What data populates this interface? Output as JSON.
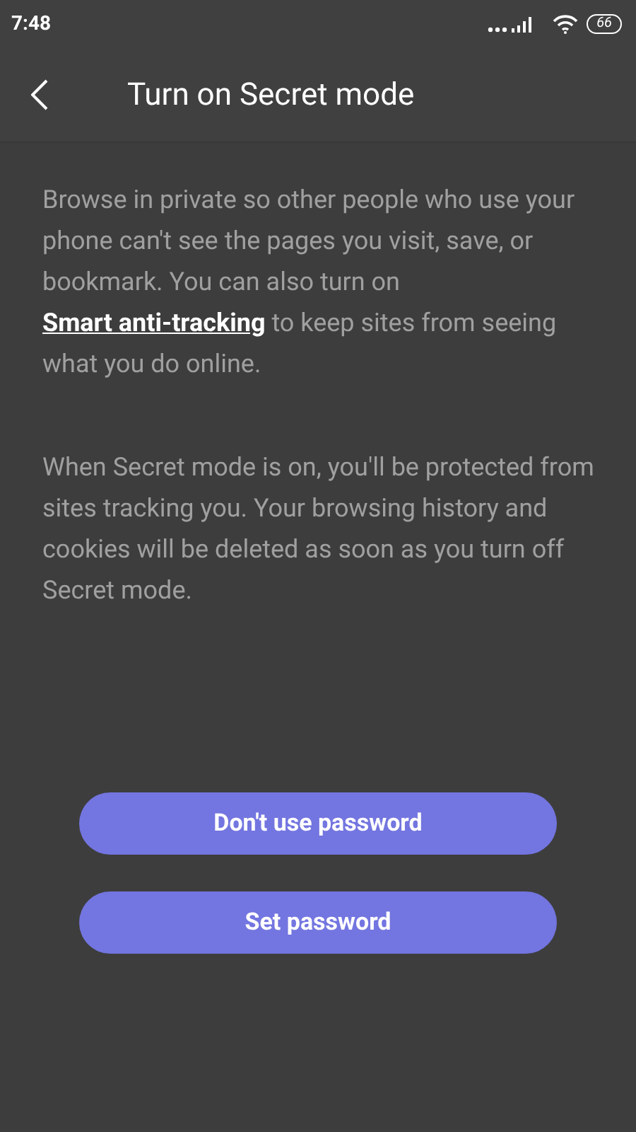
{
  "status_bar": {
    "time": "7:48",
    "battery": "66"
  },
  "header": {
    "title": "Turn on Secret mode"
  },
  "intro": {
    "text_before": "Browse in private so other people who use your phone can't see the pages you visit, save, or bookmark. You can also turn on ",
    "link": "Smart anti-tracking",
    "text_after": " to keep sites from seeing what you do online."
  },
  "note": "When Secret mode is on, you'll be protected from sites tracking you. Your browsing history and cookies will be deleted as soon as you turn off Secret mode.",
  "buttons": [
    "Don't use password",
    "Set password"
  ]
}
